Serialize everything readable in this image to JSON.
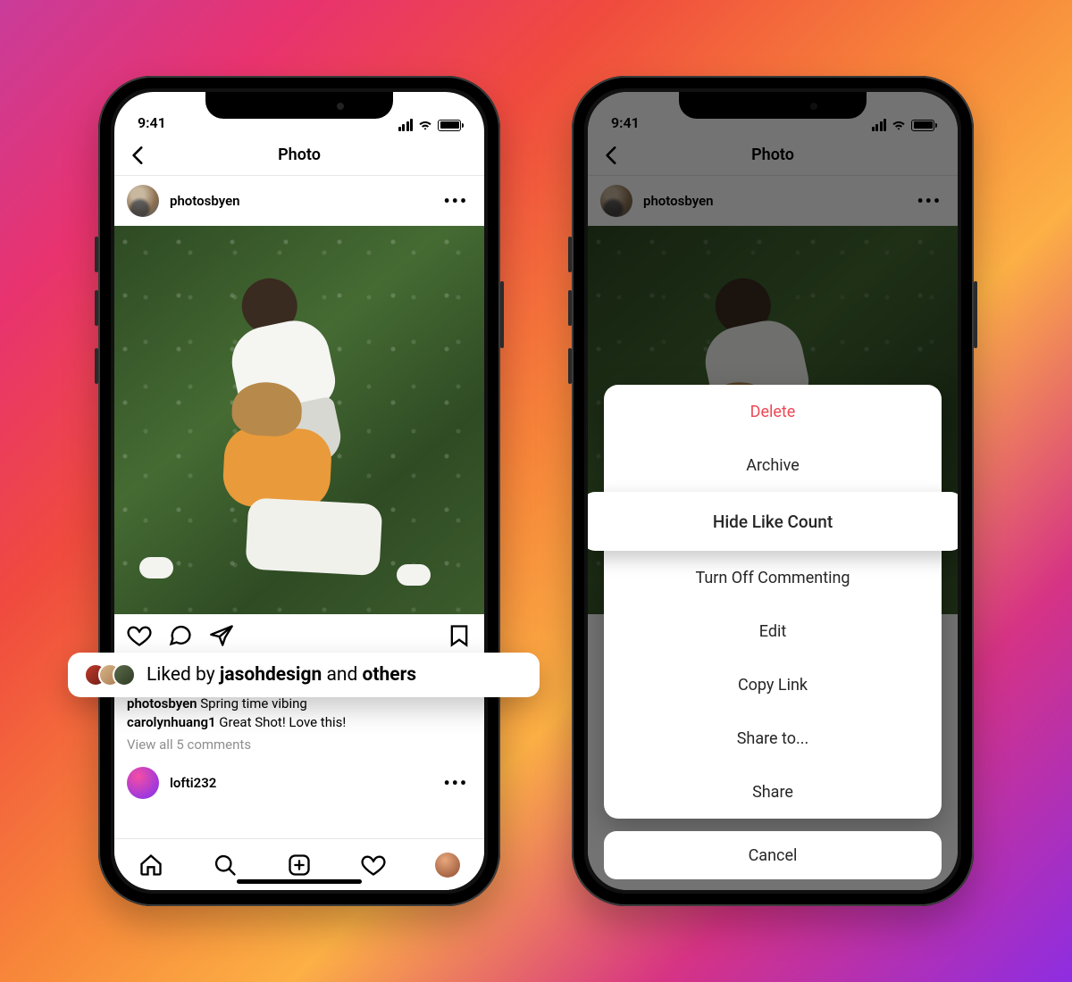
{
  "status": {
    "time": "9:41"
  },
  "nav": {
    "title": "Photo"
  },
  "post": {
    "author": "photosbyen",
    "liked_by_prefix": "Liked by ",
    "liked_by_user": "jasohdesign",
    "liked_by_middle": " and ",
    "liked_by_suffix": "others",
    "caption_author": "photosbyen",
    "caption_text": " Spring time vibing",
    "comment_author": "carolynhuang1",
    "comment_text": " Great Shot! Love this!",
    "view_all": "View all 5 comments"
  },
  "post2": {
    "author": "lofti232"
  },
  "sheet": {
    "items": [
      {
        "label": "Delete",
        "kind": "danger"
      },
      {
        "label": "Archive",
        "kind": "normal"
      },
      {
        "label": "Hide Like Count",
        "kind": "highlight"
      },
      {
        "label": "Turn Off Commenting",
        "kind": "normal"
      },
      {
        "label": "Edit",
        "kind": "normal"
      },
      {
        "label": "Copy Link",
        "kind": "normal"
      },
      {
        "label": "Share to...",
        "kind": "normal"
      },
      {
        "label": "Share",
        "kind": "normal"
      }
    ],
    "cancel": "Cancel"
  }
}
